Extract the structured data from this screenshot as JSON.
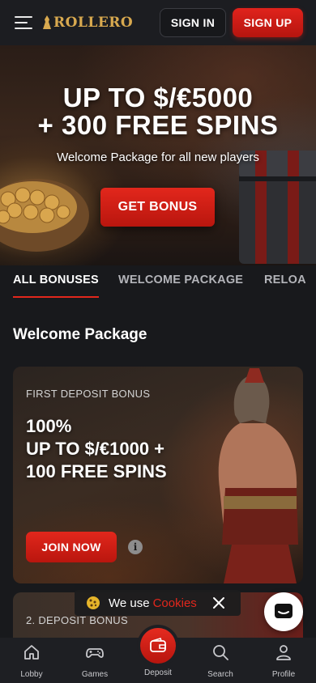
{
  "header": {
    "logo_text": "ROLLERO",
    "sign_in": "SIGN IN",
    "sign_up": "SIGN UP"
  },
  "hero": {
    "title_line1": "UP TO $/€5000",
    "title_line2": "+ 300 FREE SPINS",
    "subtitle": "Welcome Package for all new players",
    "cta": "GET BONUS"
  },
  "tabs": [
    {
      "label": "ALL BONUSES",
      "active": true
    },
    {
      "label": "WELCOME PACKAGE",
      "active": false
    },
    {
      "label": "RELOA",
      "active": false
    }
  ],
  "section_title": "Welcome Package",
  "card1": {
    "label": "FIRST DEPOSIT BONUS",
    "title_line1": "100%",
    "title_line2": "UP TO $/€1000 +",
    "title_line3": "100 FREE SPINS",
    "cta": "JOIN NOW",
    "info_glyph": "i"
  },
  "card2": {
    "label": "2. DEPOSIT BONUS"
  },
  "cookie": {
    "text": "We use",
    "link": "Cookies"
  },
  "bottom_nav": {
    "lobby": "Lobby",
    "games": "Games",
    "deposit": "Deposit",
    "search": "Search",
    "profile": "Profile"
  },
  "colors": {
    "accent_red": "#e2271c",
    "logo_gold": "#d8a94f",
    "background": "#18191c"
  }
}
